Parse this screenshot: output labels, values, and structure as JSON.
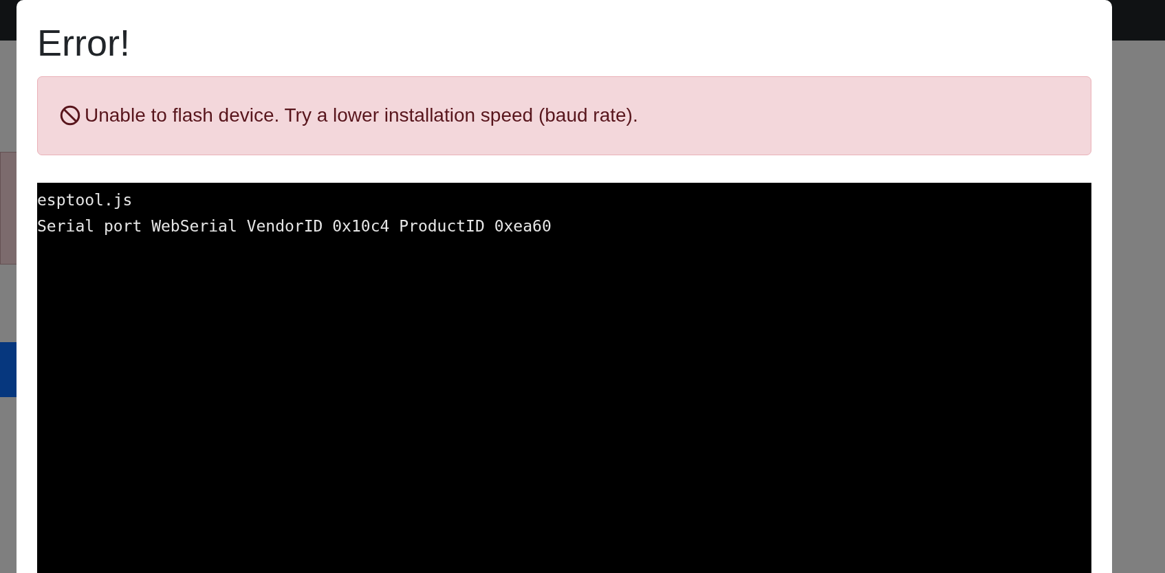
{
  "dialog": {
    "title": "Error!",
    "alert": {
      "kind": "danger",
      "text": "Unable to flash device. Try a lower installation speed (baud rate)."
    },
    "console": {
      "lines": [
        "esptool.js",
        "Serial port WebSerial VendorID 0x10c4 ProductID 0xea60"
      ]
    }
  }
}
